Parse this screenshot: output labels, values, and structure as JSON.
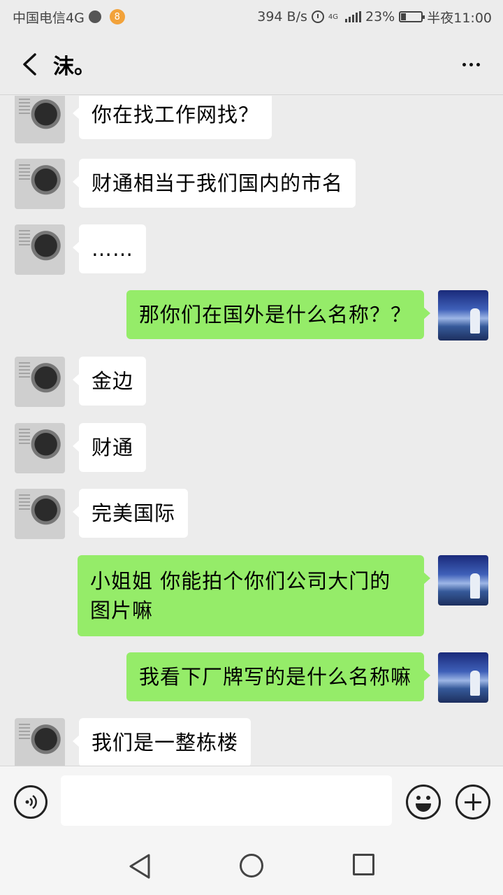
{
  "status_bar": {
    "carrier": "中国电信4G",
    "app_badge": "8",
    "net_speed": "394 B/s",
    "network": "4G",
    "battery": "23%",
    "battery_level": 0.23,
    "time": "半夜11:00"
  },
  "header": {
    "title": "沫。"
  },
  "messages": [
    {
      "side": "left",
      "text": "你在找工作网找？"
    },
    {
      "side": "left",
      "text": "财通相当于我们国内的市名"
    },
    {
      "side": "left",
      "text": "……"
    },
    {
      "side": "right",
      "text": "那你们在国外是什么名称？？"
    },
    {
      "side": "left",
      "text": "金边"
    },
    {
      "side": "left",
      "text": "财通"
    },
    {
      "side": "left",
      "text": "完美国际"
    },
    {
      "side": "right",
      "text": "小姐姐 你能拍个你们公司大门的图片嘛"
    },
    {
      "side": "right",
      "text": "我看下厂牌写的是什么名称嘛"
    },
    {
      "side": "left",
      "text": "我们是一整栋楼"
    }
  ],
  "input": {
    "value": "",
    "placeholder": ""
  },
  "colors": {
    "background": "#ececec",
    "sent_bubble": "#95ec69",
    "received_bubble": "#ffffff"
  },
  "icons": {
    "back": "chevron-left-icon",
    "more": "more-icon",
    "voice": "voice-icon",
    "emoji": "emoji-icon",
    "plus": "plus-icon"
  }
}
